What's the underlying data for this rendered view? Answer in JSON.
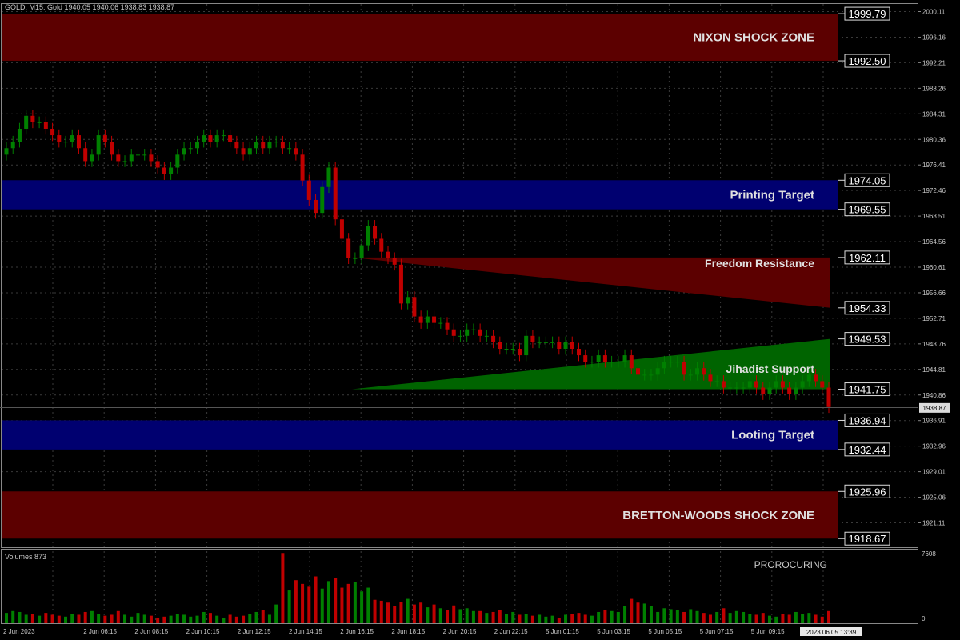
{
  "header": {
    "text": "GOLD, M15:  Gold  1940.05 1940.06 1938.83 1938.87"
  },
  "price_axis": {
    "ticks": [
      "2000.11",
      "1996.16",
      "1992.21",
      "1988.26",
      "1984.31",
      "1980.36",
      "1976.41",
      "1972.46",
      "1968.51",
      "1964.56",
      "1960.61",
      "1956.66",
      "1952.71",
      "1948.76",
      "1944.81",
      "1940.86",
      "1936.91",
      "1932.96",
      "1929.01",
      "1925.06",
      "1921.11"
    ],
    "current_price": "1938.87"
  },
  "zones": [
    {
      "label": "NIXON SHOCK ZONE",
      "top": 1999.79,
      "bottom": 1992.5,
      "top_label": "1999.79",
      "bottom_label": "1992.50",
      "color": "#5c0000"
    },
    {
      "label": "Printing Target",
      "top": 1974.05,
      "bottom": 1969.55,
      "top_label": "1974.05",
      "bottom_label": "1969.55",
      "color": "#000070"
    },
    {
      "label": "Looting Target",
      "top": 1936.94,
      "bottom": 1932.44,
      "top_label": "1936.94",
      "bottom_label": "1932.44",
      "color": "#000070"
    },
    {
      "label": "BRETTON-WOODS SHOCK ZONE",
      "top": 1925.96,
      "bottom": 1918.67,
      "top_label": "1925.96",
      "bottom_label": "1918.67",
      "color": "#5c0000"
    }
  ],
  "triangles": [
    {
      "label": "Freedom Resistance",
      "top_label": "1962.11",
      "bottom_label": "1954.33",
      "apex": 1962.11,
      "right_top": 1962.11,
      "right_bottom": 1954.33,
      "color": "#5c0000"
    },
    {
      "label": "Jihadist Support",
      "top_label": "1949.53",
      "bottom_label": "1941.75",
      "apex": 1941.75,
      "right_top": 1949.53,
      "right_bottom": 1941.75,
      "color": "#006400"
    }
  ],
  "volume_panel": {
    "title": "Volumes 873",
    "brand": "PROROCURING",
    "scale_top": "7608",
    "scale_bottom": "0"
  },
  "time_axis": {
    "labels": [
      "2 Jun 2023",
      "2 Jun 06:15",
      "2 Jun 08:15",
      "2 Jun 10:15",
      "2 Jun 12:15",
      "2 Jun 14:15",
      "2 Jun 16:15",
      "2 Jun 18:15",
      "2 Jun 20:15",
      "2 Jun 22:15",
      "5 Jun 01:15",
      "5 Jun 03:15",
      "5 Jun 05:15",
      "5 Jun 07:15",
      "5 Jun 09:15",
      "5 Jun 11:15"
    ],
    "cursor_time": "2023.06.05 13:39"
  },
  "chart_data": {
    "type": "candlestick",
    "symbol": "GOLD",
    "timeframe": "M15",
    "ylim": [
      1918.0,
      2001.5
    ],
    "candles_close": [
      1979,
      1980,
      1982,
      1984,
      1983,
      1983,
      1982,
      1981,
      1980,
      1980,
      1981,
      1979,
      1977,
      1978,
      1981,
      1980,
      1978,
      1977,
      1977,
      1978,
      1978,
      1978,
      1977,
      1976,
      1975,
      1976,
      1978,
      1979,
      1979,
      1980,
      1981,
      1980,
      1981,
      1981,
      1980,
      1979,
      1978,
      1979,
      1980,
      1979,
      1980,
      1980,
      1979,
      1979,
      1978,
      1974,
      1971,
      1969,
      1973,
      1976,
      1968,
      1965,
      1962,
      1962,
      1964,
      1967,
      1965,
      1963,
      1962,
      1961,
      1955,
      1956,
      1953,
      1952,
      1953,
      1952,
      1952,
      1951,
      1950,
      1950,
      1951,
      1951,
      1950,
      1950,
      1949,
      1948,
      1948,
      1948,
      1947,
      1950,
      1949,
      1949,
      1949,
      1949,
      1948,
      1949,
      1948,
      1947,
      1946,
      1946,
      1947,
      1946,
      1946,
      1946,
      1947,
      1945,
      1944,
      1944,
      1944,
      1945,
      1946,
      1946,
      1946,
      1944,
      1944,
      1945,
      1944,
      1943,
      1943,
      1942,
      1942,
      1942,
      1942,
      1943,
      1942,
      1941,
      1942,
      1943,
      1942,
      1941,
      1942,
      1943,
      1944,
      1943,
      1942,
      1939
    ],
    "volumes": [
      1100,
      1300,
      1200,
      900,
      1000,
      800,
      1100,
      900,
      800,
      700,
      1000,
      900,
      1200,
      1300,
      1000,
      800,
      900,
      1300,
      900,
      700,
      1100,
      900,
      800,
      600,
      700,
      800,
      1000,
      900,
      700,
      800,
      1200,
      1100,
      800,
      600,
      900,
      700,
      800,
      1000,
      1200,
      1400,
      900,
      2000,
      7500,
      3500,
      4600,
      4200,
      3900,
      5000,
      3700,
      4500,
      4800,
      3800,
      4200,
      4400,
      3400,
      3800,
      2500,
      2400,
      2200,
      1800,
      2300,
      2600,
      2000,
      2200,
      1700,
      2000,
      1600,
      1400,
      1900,
      1500,
      1600,
      1300,
      1300,
      1100,
      1200,
      1400,
      1000,
      1200,
      900,
      1000,
      800,
      900,
      700,
      800,
      600,
      900,
      1000,
      1100,
      900,
      800,
      1200,
      1400,
      1300,
      1200,
      1800,
      2600,
      2200,
      2100,
      1800,
      1200,
      1600,
      1500,
      1400,
      1200,
      1500,
      1300,
      1100,
      900,
      1200,
      1600,
      1100,
      1300,
      1200,
      1000,
      900,
      1100,
      800,
      700,
      1000,
      900,
      1200,
      1000,
      1100,
      900,
      700,
      1300
    ],
    "candle_colors": {
      "up": "#008000",
      "down": "#c00000"
    }
  }
}
